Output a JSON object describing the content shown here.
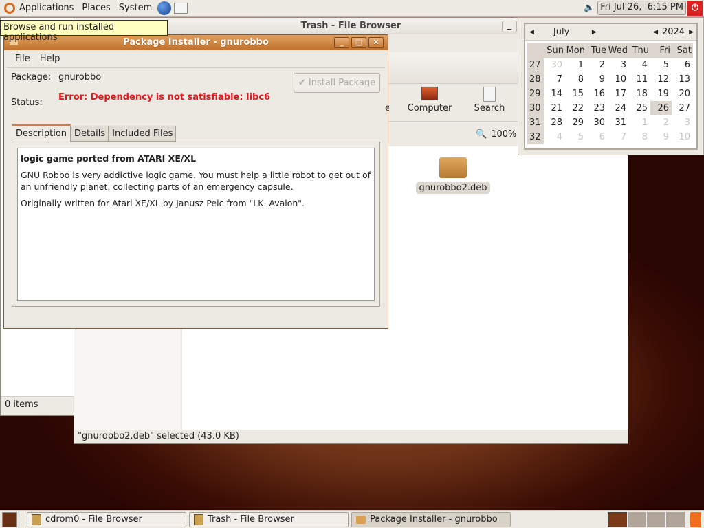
{
  "top_panel": {
    "menus": [
      "Applications",
      "Places",
      "System"
    ],
    "clock": "Fri Jul 26,  6:15 PM"
  },
  "tooltip": "Browse and run installed applications",
  "cdrom_window": {
    "status": "0 items"
  },
  "trash_window": {
    "title": "Trash - File Browser",
    "toolbar": {
      "computer": "Computer",
      "search": "Search",
      "partial": "e"
    },
    "zoom": "100%",
    "file": {
      "name": "gnurobbo2.deb"
    },
    "status": "\"gnurobbo2.deb\" selected (43.0 KB)"
  },
  "calendar": {
    "month": "July",
    "year": "2024",
    "days": [
      "Sun",
      "Mon",
      "Tue",
      "Wed",
      "Thu",
      "Fri",
      "Sat"
    ],
    "weeks": [
      {
        "wk": "27",
        "d": [
          "30",
          "1",
          "2",
          "3",
          "4",
          "5",
          "6"
        ],
        "dim": [
          0
        ]
      },
      {
        "wk": "28",
        "d": [
          "7",
          "8",
          "9",
          "10",
          "11",
          "12",
          "13"
        ],
        "dim": []
      },
      {
        "wk": "29",
        "d": [
          "14",
          "15",
          "16",
          "17",
          "18",
          "19",
          "20"
        ],
        "dim": []
      },
      {
        "wk": "30",
        "d": [
          "21",
          "22",
          "23",
          "24",
          "25",
          "26",
          "27"
        ],
        "dim": [],
        "sel": 5
      },
      {
        "wk": "31",
        "d": [
          "28",
          "29",
          "30",
          "31",
          "1",
          "2",
          "3"
        ],
        "dim": [
          4,
          5,
          6
        ]
      },
      {
        "wk": "32",
        "d": [
          "4",
          "5",
          "6",
          "7",
          "8",
          "9",
          "10"
        ],
        "dim": [
          0,
          1,
          2,
          3,
          4,
          5,
          6
        ]
      }
    ]
  },
  "installer": {
    "title": "Package Installer - gnurobbo",
    "menu": [
      "File",
      "Help"
    ],
    "package_label": "Package:",
    "package": "gnurobbo",
    "status_label": "Status:",
    "status": "Error: Dependency is not satisfiable: libc6",
    "install_button": "Install Package",
    "tabs": [
      "Description",
      "Details",
      "Included Files"
    ],
    "description": {
      "heading": "logic game ported from ATARI XE/XL",
      "p1": "GNU Robbo is very addictive logic game. You must help a little robot to get out of an unfriendly planet, collecting parts of an emergency capsule.",
      "p2": "Originally written for Atari XE/XL by Janusz Pelc from \"LK. Avalon\"."
    }
  },
  "taskbar": [
    "cdrom0 - File Browser",
    "Trash - File Browser",
    "Package Installer - gnurobbo"
  ],
  "colors": {
    "error": "#e8161a",
    "title_active": "#c77a35"
  }
}
